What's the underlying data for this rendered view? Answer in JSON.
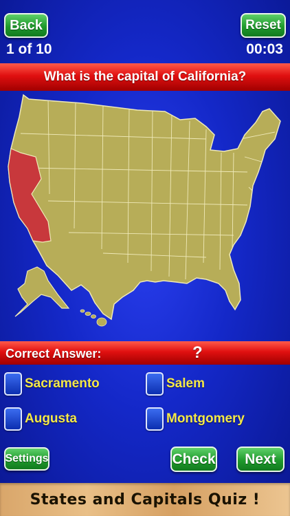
{
  "header": {
    "back_label": "Back",
    "reset_label": "Reset",
    "progress": "1 of 10",
    "timer": "00:03"
  },
  "question": "What is the capital of California?",
  "answer": {
    "label": "Correct Answer:",
    "value": "?"
  },
  "choices": [
    "Sacramento",
    "Salem",
    "Augusta",
    "Montgomery"
  ],
  "controls": {
    "settings_label": "Settings",
    "check_label": "Check",
    "next_label": "Next"
  },
  "footer": {
    "title": "States and Capitals Quiz !"
  },
  "map": {
    "highlighted_state": "California",
    "colors": {
      "state_fill": "#b7ad58",
      "state_border": "#efe9b8",
      "highlight_fill": "#c8383c",
      "ocean": "#1428c8"
    }
  },
  "icons": {
    "choice_checkbox": "blue-square-checkbox-icon"
  }
}
